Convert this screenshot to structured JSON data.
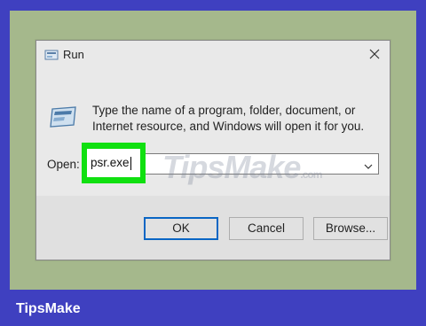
{
  "dialog": {
    "title": "Run",
    "description_line1": "Type the name of a program, folder, document, or",
    "description_line2": "Internet resource, and Windows will open it for you.",
    "open_label": "Open:",
    "open_value": "psr.exe",
    "buttons": {
      "ok": "OK",
      "cancel": "Cancel",
      "browse": "Browse..."
    },
    "accent_color": "#0a66c4",
    "highlight_color": "#10e010"
  },
  "watermark": {
    "text": "TipsMake",
    "domain": ".com"
  },
  "brand": {
    "text": "TipsMake"
  },
  "icons": [
    "run-app-icon",
    "close-icon",
    "run-program-icon",
    "chevron-down-icon"
  ]
}
